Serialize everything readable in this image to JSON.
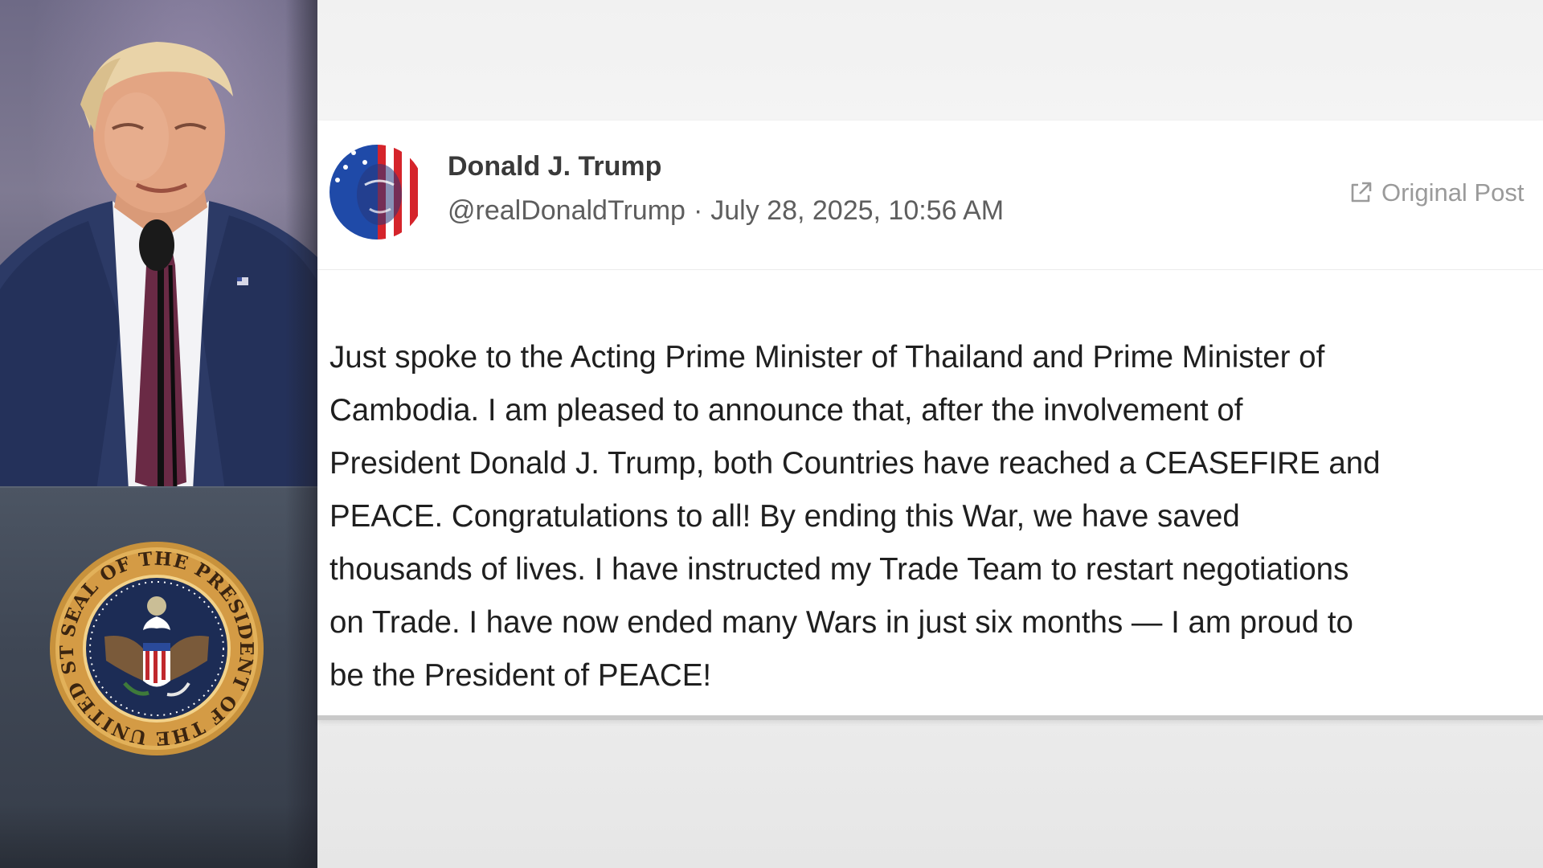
{
  "post": {
    "author_name": "Donald J. Trump",
    "handle": "@realDonaldTrump",
    "separator": "·",
    "timestamp": "July 28, 2025, 10:56 AM",
    "original_post_label": "Original Post",
    "body": "Just spoke to the Acting Prime Minister of Thailand and Prime Minister of\nCambodia. I am pleased to announce that, after the involvement of\nPresident Donald J. Trump, both Countries have reached a CEASEFIRE and\nPEACE. Congratulations to all! By ending this War, we have saved\nthousands of lives. I have instructed my Trade Team to restart negotiations\non Trade. I have now ended many Wars in just six months — I am proud to\nbe the President of PEACE!"
  },
  "seal": {
    "ring_text": "SEAL OF THE PRESIDENT OF THE UNITED STATES"
  },
  "icons": {
    "external_link": "external-link-icon"
  },
  "colors": {
    "card_background": "#ffffff",
    "name_text": "#3a3a3a",
    "meta_text": "#5e5e5e",
    "link_gray": "#9a9a9a",
    "seal_gold": "#c8923c",
    "seal_navy": "#1c2c55"
  }
}
